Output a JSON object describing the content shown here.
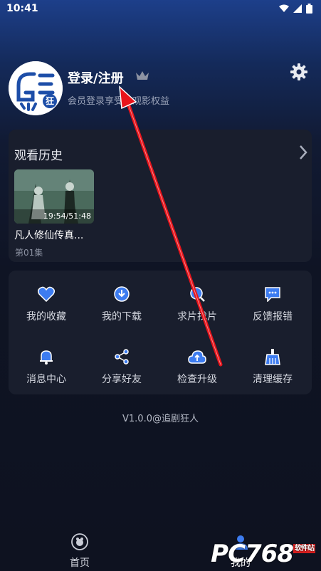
{
  "status_bar": {
    "time": "10:41"
  },
  "profile": {
    "login_label": "登录/注册",
    "subtitle": "会员登录享受多观影权益",
    "avatar_text": "狂"
  },
  "history": {
    "title": "观看历史",
    "items": [
      {
        "progress": "19:54/51:48",
        "title": "凡人修仙传真...",
        "episode": "第01集"
      }
    ]
  },
  "features": [
    {
      "icon": "heart-icon",
      "label": "我的收藏"
    },
    {
      "icon": "download-icon",
      "label": "我的下载"
    },
    {
      "icon": "search-film-icon",
      "label": "求片找片"
    },
    {
      "icon": "feedback-icon",
      "label": "反馈报错"
    },
    {
      "icon": "bell-icon",
      "label": "消息中心"
    },
    {
      "icon": "share-icon",
      "label": "分享好友"
    },
    {
      "icon": "cloud-upgrade-icon",
      "label": "检查升级"
    },
    {
      "icon": "broom-icon",
      "label": "清理缓存"
    }
  ],
  "version": "V1.0.0@追剧狂人",
  "tabs": [
    {
      "label": "首页"
    },
    {
      "label": "我的"
    }
  ],
  "colors": {
    "accent": "#3d7cf0",
    "card": "#191e2d",
    "arrow": "#e8141b"
  },
  "watermark": {
    "text": "PC768",
    "small": "软件站"
  }
}
